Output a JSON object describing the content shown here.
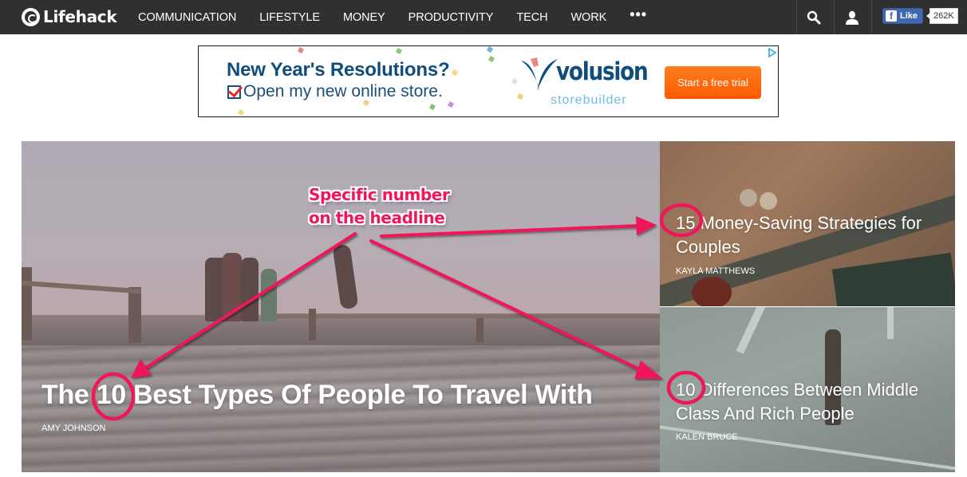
{
  "header": {
    "logo_text": "Lifehack",
    "nav_items": [
      {
        "label": "COMMUNICATION"
      },
      {
        "label": "LIFESTYLE"
      },
      {
        "label": "MONEY"
      },
      {
        "label": "PRODUCTIVITY"
      },
      {
        "label": "TECH"
      },
      {
        "label": "WORK"
      }
    ],
    "more_label": "•••",
    "search_icon": "search-icon",
    "user_icon": "user-icon",
    "facebook": {
      "like_label": "Like",
      "count": "262K"
    }
  },
  "ad": {
    "headline": "New Year's Resolutions?",
    "subline": "Open my new online store.",
    "brand": "volusion",
    "brand_sub": "storebuilder",
    "cta_label": "Start a free trial",
    "colors": {
      "brand": "#0e4d7c",
      "cta": "#ff6a0a",
      "check": "#e8262b"
    }
  },
  "featured": {
    "main": {
      "title": "The 10 Best Types Of People To Travel With",
      "author": "AMY JOHNSON"
    },
    "side": [
      {
        "title": "15 Money-Saving Strategies for Couples",
        "author": "KAYLA MATTHEWS"
      },
      {
        "title": "10 Differences Between Middle Class And Rich People",
        "author": "KALEN BRUCE"
      }
    ]
  },
  "annotation": {
    "line1": "Specific number",
    "line2": "on the headline",
    "color": "#f0165a"
  }
}
